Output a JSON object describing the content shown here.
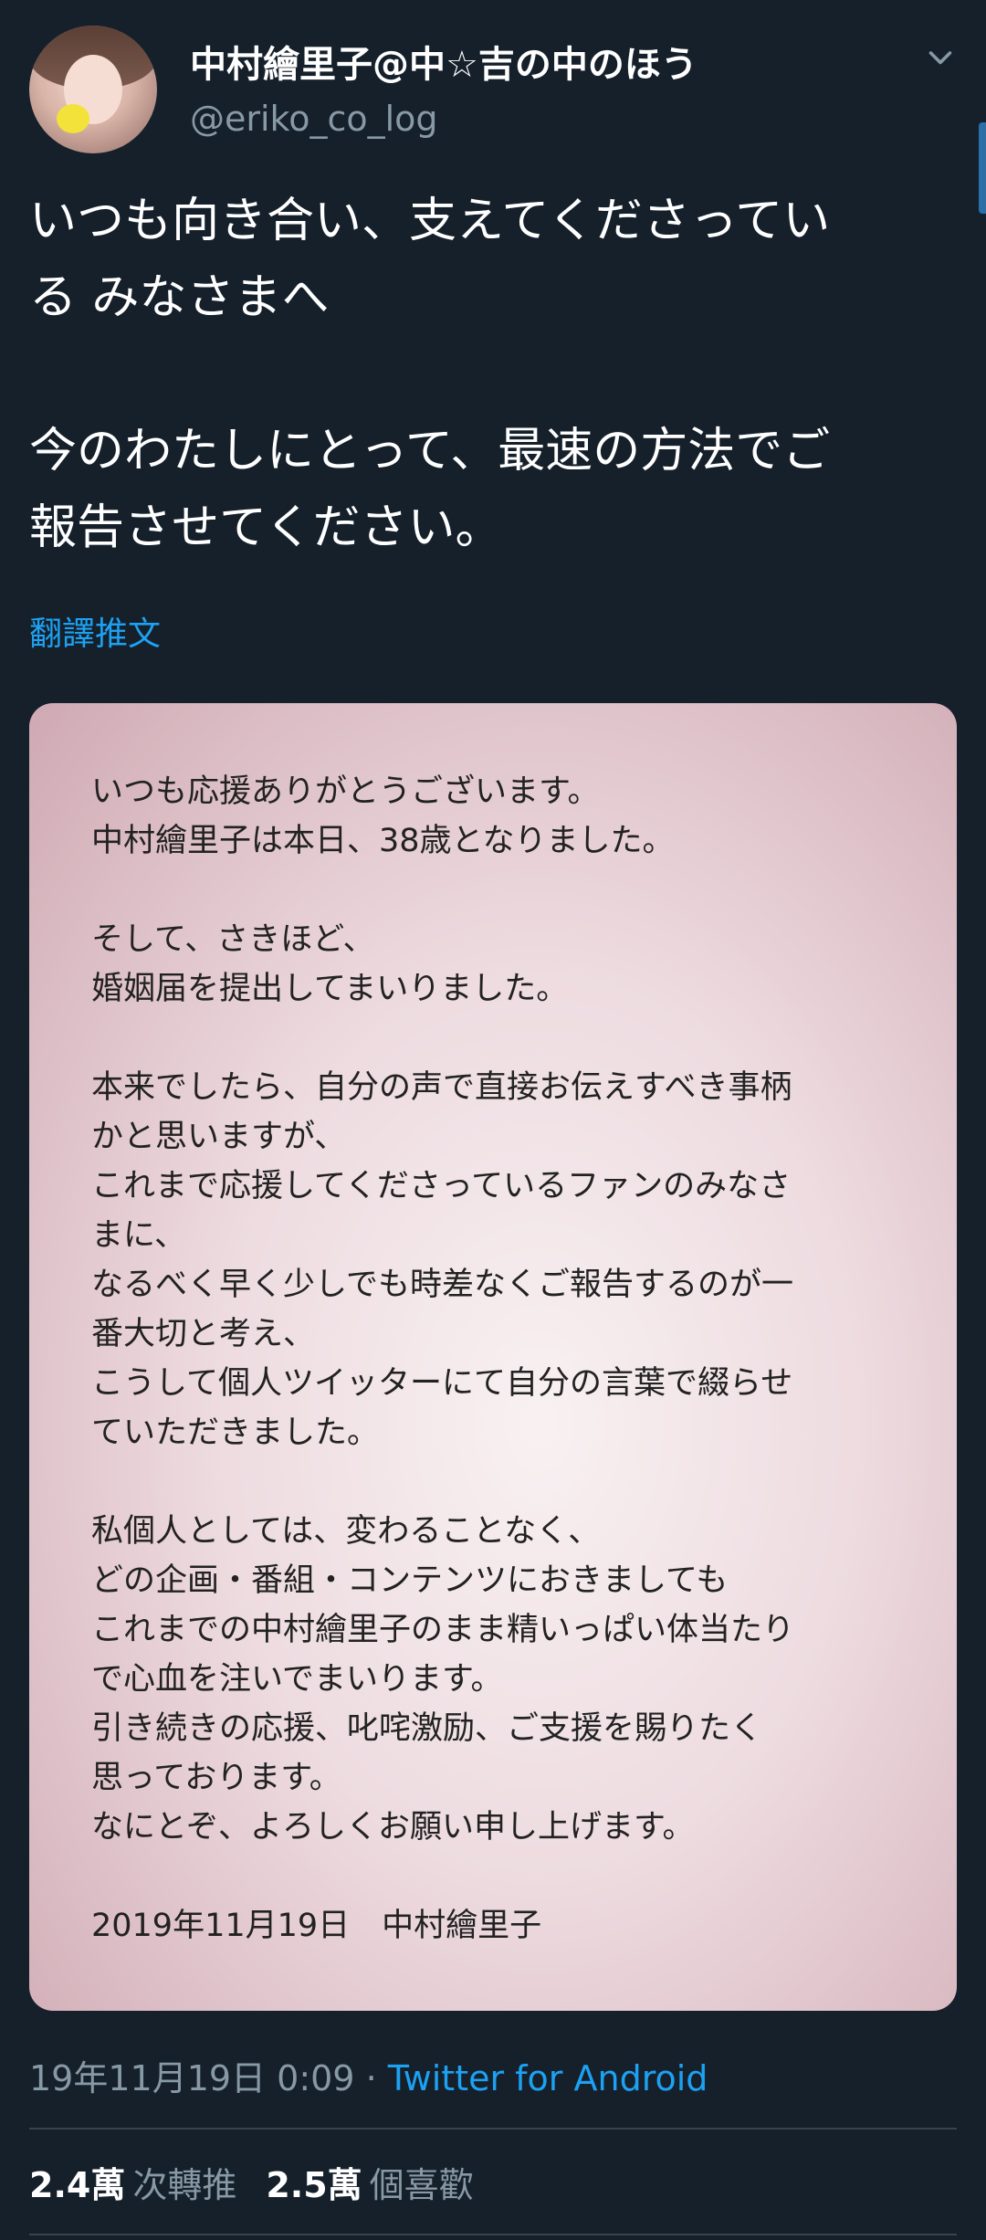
{
  "user": {
    "display_name": "中村繪里子@中☆吉の中のほう",
    "handle": "@eriko_co_log"
  },
  "tweet": {
    "text_lines": [
      "いつも向き合い、支えてくださってい",
      "る みなさまへ",
      "",
      "今のわたしにとって、最速の方法でご",
      "報告させてください。"
    ],
    "translate_label": "翻譯推文"
  },
  "card": {
    "lines": [
      "いつも応援ありがとうございます。",
      "中村繪里子は本日、38歳となりました。",
      "",
      "そして、さきほど、",
      "婚姻届を提出してまいりました。",
      "",
      "本来でしたら、自分の声で直接お伝えすべき事柄",
      "かと思いますが、",
      "これまで応援してくださっているファンのみなさ",
      "まに、",
      "なるべく早く少しでも時差なくご報告するのが一",
      "番大切と考え、",
      "こうして個人ツイッターにて自分の言葉で綴らせ",
      "ていただきました。",
      "",
      "私個人としては、変わることなく、",
      "どの企画・番組・コンテンツにおきましても",
      "これまでの中村繪里子のまま精いっぱい体当たり",
      "で心血を注いでまいります。",
      "引き続きの応援、叱咤激励、ご支援を賜りたく",
      "思っております。",
      "なにとぞ、よろしくお願い申し上げます。",
      "",
      "2019年11月19日　中村繪里子"
    ]
  },
  "meta": {
    "timestamp": "19年11月19日 0:09",
    "separator": " · ",
    "source": "Twitter for Android"
  },
  "stats": {
    "retweets_count": "2.4萬",
    "retweets_label": "次轉推",
    "likes_count": "2.5萬",
    "likes_label": "個喜歡"
  },
  "icons": {
    "chevron": "chevron-down-icon"
  },
  "colors": {
    "background": "#15202b",
    "link": "#1da1f2",
    "secondary_text": "#8899a6"
  }
}
